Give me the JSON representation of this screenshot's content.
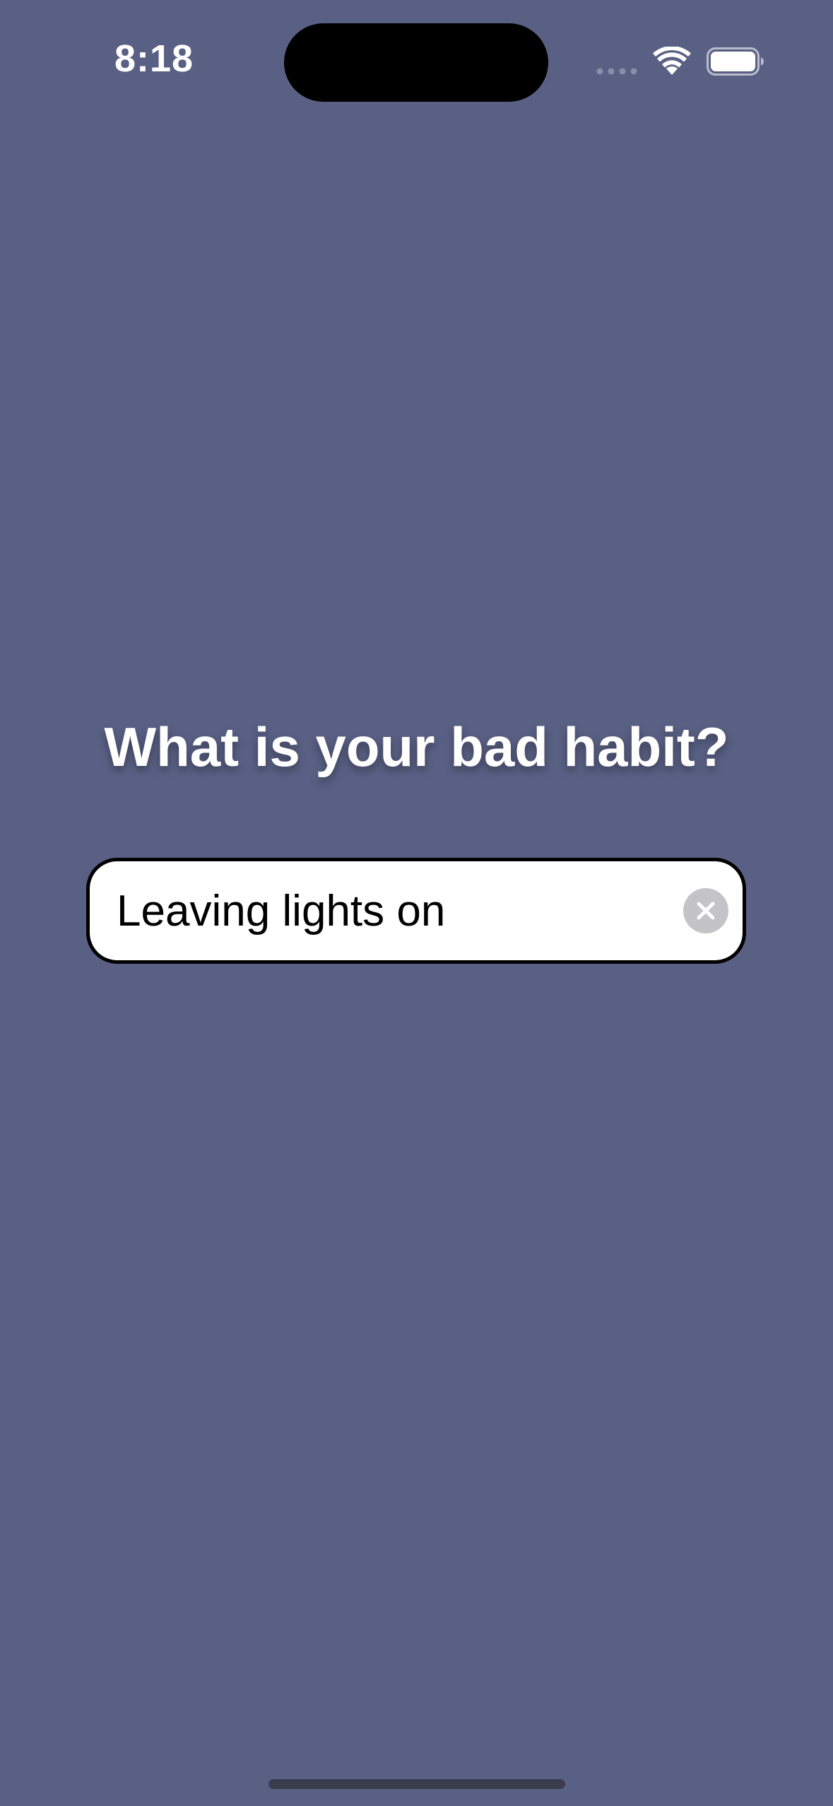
{
  "status_bar": {
    "time": "8:18",
    "icons": [
      "cellular-dots-icon",
      "wifi-icon",
      "battery-icon"
    ]
  },
  "main": {
    "question": "What is your bad habit?",
    "habit_input": {
      "value": "Leaving lights on",
      "clear_icon": "clear-x-icon"
    }
  },
  "colors": {
    "background": "#596084",
    "text_light": "#ffffff",
    "field_background": "#ffffff",
    "field_border": "#000000",
    "clear_button": "#c4c4c6"
  }
}
